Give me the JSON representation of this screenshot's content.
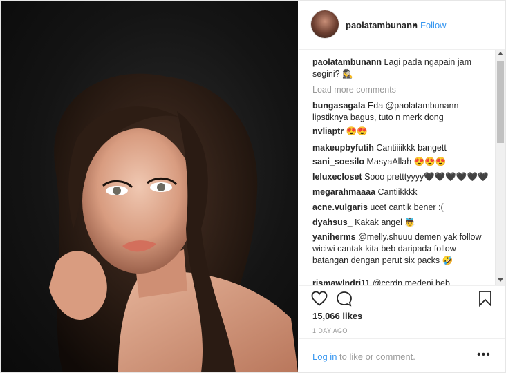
{
  "post": {
    "username": "paolatambunann",
    "separator": "•",
    "follow_label": "Follow"
  },
  "caption": {
    "user": "paolatambunann",
    "text": "Lagi pada ngapain jam segini? 🕵️‍♀️"
  },
  "load_more_label": "Load more comments",
  "comments": [
    {
      "user": "bungasagala",
      "text": "Eda @paolatambunann lipstiknya bagus, tuto n merk dong"
    },
    {
      "user": "nvliaptr",
      "text": "😍😍"
    },
    {
      "user": "makeupbyfutih",
      "text": "Cantiiiikkk bangett"
    },
    {
      "user": "sani_soesilo",
      "text": "MasyaAllah 😍😍😍"
    },
    {
      "user": "leluxecloset",
      "text": "Sooo pretttyyyy🖤🖤🖤🖤🖤🖤"
    },
    {
      "user": "megarahmaaaa",
      "text": "Cantiikkkk"
    },
    {
      "user": "acne.vulgaris",
      "text": "ucet cantik bener :("
    },
    {
      "user": "dyahsus_",
      "text": "Kakak angel 👼"
    },
    {
      "user": "yaniherms",
      "text": "@melly.shuuu demen yak follow wiciwi cantak kita beb daripada follow batangan dengan perut six packs 🤣"
    },
    {
      "user": "rismawlndri11",
      "text": "@ccrdn medeni beb"
    }
  ],
  "likes": "15,066 likes",
  "time_ago": "1 DAY AGO",
  "login": {
    "link_label": "Log in",
    "rest": " to like or comment."
  },
  "more_label": "•••",
  "colors": {
    "link_blue": "#3897f0",
    "muted": "#999999",
    "text": "#262626"
  },
  "icons": [
    "heart-icon",
    "comment-icon",
    "bookmark-icon",
    "more-options-icon"
  ]
}
